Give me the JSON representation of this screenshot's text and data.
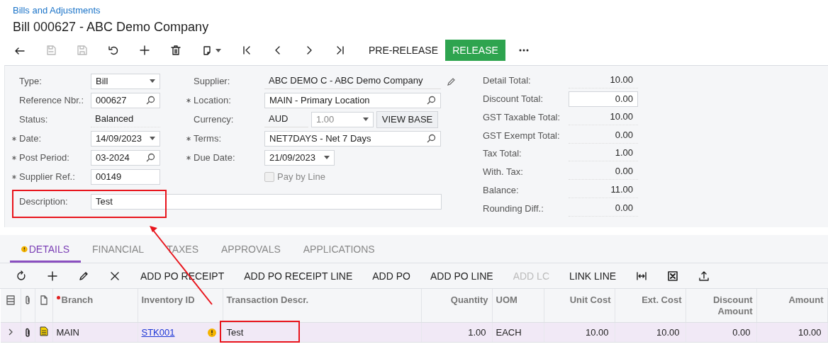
{
  "breadcrumb": "Bills and Adjustments",
  "title": "Bill 000627 - ABC Demo Company",
  "toolbar": [
    {
      "kind": "icon",
      "disabled": false
    },
    {
      "kind": "icon",
      "disabled": true
    },
    {
      "kind": "icon",
      "disabled": true
    },
    {
      "kind": "icon",
      "disabled": false
    },
    {
      "kind": "icon",
      "disabled": false
    },
    {
      "kind": "icon",
      "disabled": false
    },
    {
      "kind": "menu",
      "disabled": false
    },
    {
      "kind": "icon",
      "disabled": false
    },
    {
      "kind": "icon",
      "disabled": false
    },
    {
      "kind": "icon",
      "disabled": false
    },
    {
      "kind": "icon",
      "disabled": false
    },
    {
      "kind": "text",
      "label": "PRE-RELEASE",
      "disabled": false
    },
    {
      "kind": "primary",
      "label": "RELEASE",
      "disabled": false
    },
    {
      "kind": "icon",
      "disabled": false
    }
  ],
  "form": {
    "column_1": [
      {
        "label": "Type:",
        "required": false,
        "kind": "select",
        "value": "Bill"
      },
      {
        "label": "Reference Nbr.:",
        "required": false,
        "kind": "search",
        "value": "000627"
      },
      {
        "label": "Status:",
        "required": false,
        "kind": "readonly",
        "value": "Balanced"
      },
      {
        "label": "Date:",
        "required": true,
        "kind": "select",
        "value": "14/09/2023"
      },
      {
        "label": "Post Period:",
        "required": true,
        "kind": "search",
        "value": "03-2024"
      },
      {
        "label": "Supplier Ref.:",
        "required": true,
        "kind": "text",
        "value": "00149"
      }
    ],
    "column_2": [
      {
        "label": "Supplier:",
        "required": false,
        "kind": "readonly-edit",
        "value": "ABC DEMO C - ABC Demo Company"
      },
      {
        "label": "Location:",
        "required": true,
        "kind": "search",
        "value": "MAIN - Primary Location"
      },
      {
        "label": "Currency:",
        "required": false,
        "kind": "currency",
        "value": "AUD",
        "rate": "1.00",
        "button": "VIEW BASE"
      },
      {
        "label": "Terms:",
        "required": true,
        "kind": "search",
        "value": "NET7DAYS - Net 7 Days"
      },
      {
        "label": "Due Date:",
        "required": true,
        "kind": "select-short",
        "value": "21/09/2023"
      },
      {
        "label": "Pay by Line",
        "kind": "checkbox",
        "checked": false,
        "disabled": true
      }
    ],
    "description": {
      "label": "Description:",
      "value": "Test"
    },
    "totals": [
      {
        "label": "Detail Total:",
        "kind": "readonly",
        "value": "10.00"
      },
      {
        "label": "Discount Total:",
        "kind": "input",
        "value": "0.00"
      },
      {
        "label": "GST Taxable Total:",
        "kind": "readonly",
        "value": "10.00"
      },
      {
        "label": "GST Exempt Total:",
        "kind": "readonly",
        "value": "0.00"
      },
      {
        "label": "Tax Total:",
        "kind": "readonly",
        "value": "1.00"
      },
      {
        "label": "With. Tax:",
        "kind": "readonly",
        "value": "0.00"
      },
      {
        "label": "Balance:",
        "kind": "readonly",
        "value": "11.00"
      },
      {
        "label": "Rounding Diff.:",
        "kind": "readonly",
        "value": "0.00"
      }
    ]
  },
  "tabs": [
    {
      "label": "DETAILS",
      "selected": true,
      "warning": true
    },
    {
      "label": "FINANCIAL",
      "selected": false,
      "warning": false
    },
    {
      "label": "TAXES",
      "selected": false,
      "warning": false
    },
    {
      "label": "APPROVALS",
      "selected": false,
      "warning": false
    },
    {
      "label": "APPLICATIONS",
      "selected": false,
      "warning": false
    }
  ],
  "grid_toolbar": [
    {
      "kind": "icon",
      "disabled": false
    },
    {
      "kind": "icon",
      "disabled": false
    },
    {
      "kind": "icon",
      "disabled": false
    },
    {
      "kind": "icon",
      "disabled": false
    },
    {
      "kind": "text",
      "label": "ADD PO RECEIPT",
      "disabled": false
    },
    {
      "kind": "text",
      "label": "ADD PO RECEIPT LINE",
      "disabled": false
    },
    {
      "kind": "text",
      "label": "ADD PO",
      "disabled": false
    },
    {
      "kind": "text",
      "label": "ADD PO LINE",
      "disabled": false
    },
    {
      "kind": "text",
      "label": "ADD LC",
      "disabled": true
    },
    {
      "kind": "text",
      "label": "LINK LINE",
      "disabled": false
    },
    {
      "kind": "icon",
      "disabled": false
    },
    {
      "kind": "icon",
      "disabled": false
    },
    {
      "kind": "icon",
      "disabled": false
    }
  ],
  "table": {
    "columns": [
      {
        "kind": "icon"
      },
      {
        "kind": "icon"
      },
      {
        "kind": "icon"
      },
      {
        "kind": "text",
        "label": "Branch",
        "required": true
      },
      {
        "kind": "text",
        "label": "Inventory ID",
        "required": false
      },
      {
        "kind": "text",
        "label": "Transaction Descr.",
        "required": false
      },
      {
        "kind": "text",
        "label": "Quantity",
        "required": false
      },
      {
        "kind": "text",
        "label": "UOM",
        "required": false
      },
      {
        "kind": "text",
        "label": "Unit Cost",
        "required": false
      },
      {
        "kind": "text",
        "label": "Ext. Cost",
        "required": false
      },
      {
        "kind": "text",
        "label": "Discount Amount",
        "required": false
      },
      {
        "kind": "text",
        "label": "Amount",
        "required": false
      }
    ],
    "rows": [
      {
        "selected": true,
        "branch": "MAIN",
        "inventory_id": "STK001",
        "warning": true,
        "description": "Test",
        "quantity": "1.00",
        "uom": "EACH",
        "unit_cost": "10.00",
        "ext_cost": "10.00",
        "discount_amount": "0.00",
        "amount": "10.00"
      }
    ]
  }
}
